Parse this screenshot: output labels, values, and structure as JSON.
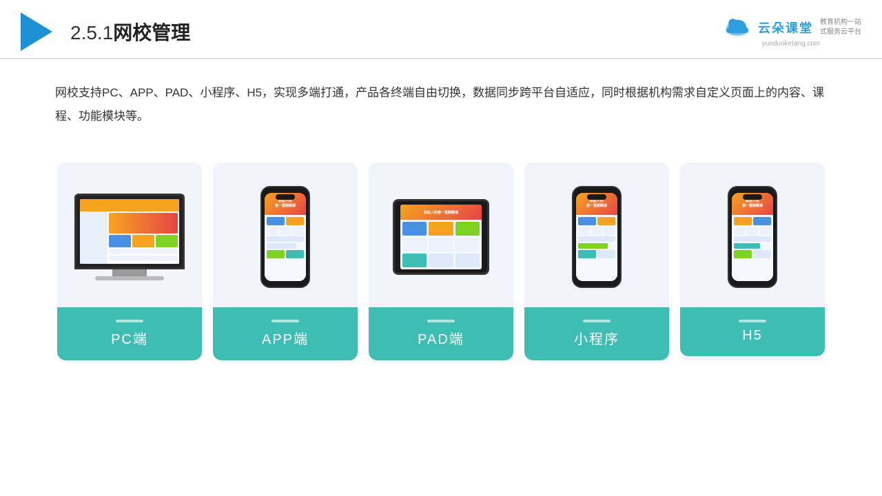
{
  "header": {
    "title": "2.5.1网校管理",
    "title_number": "2.5.1",
    "title_text": "网校管理",
    "brand": {
      "name": "云朵课堂",
      "url": "yunduoketang.com",
      "tagline": "教育机构一站\n式服务云平台"
    }
  },
  "description": {
    "text": "网校支持PC、APP、PAD、小程序、H5，实现多端打通，产品各终端自由切换，数据同步跨平台自适应，同时根据机构需求自定义页面上的内容、课程、功能模块等。"
  },
  "cards": [
    {
      "id": "pc",
      "label": "PC端"
    },
    {
      "id": "app",
      "label": "APP端"
    },
    {
      "id": "pad",
      "label": "PAD端"
    },
    {
      "id": "miniapp",
      "label": "小程序"
    },
    {
      "id": "h5",
      "label": "H5"
    }
  ]
}
